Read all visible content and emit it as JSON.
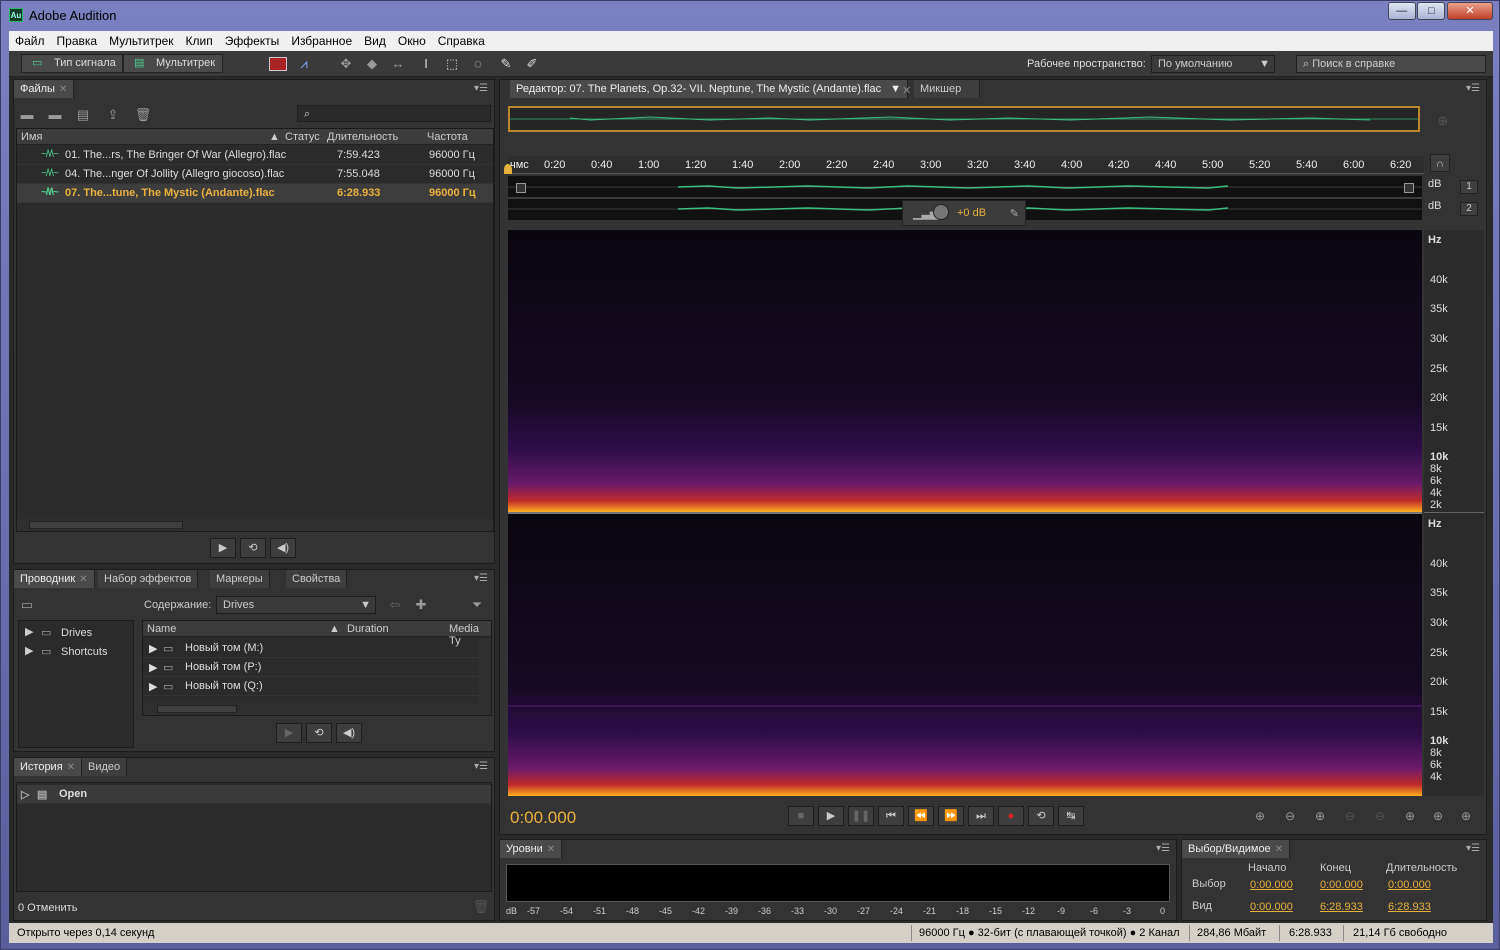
{
  "app": {
    "title": "Adobe Audition",
    "logo": "Au"
  },
  "window_controls": {
    "minimize": "—",
    "maximize": "□",
    "close": "✕"
  },
  "menu": [
    "Файл",
    "Правка",
    "Мультитрек",
    "Клип",
    "Эффекты",
    "Избранное",
    "Вид",
    "Окно",
    "Справка"
  ],
  "toolbar": {
    "waveform_btn": "Тип сигнала",
    "multitrack_btn": "Мультитрек",
    "workspace_label": "Рабочее пространство:",
    "workspace_value": "По умолчанию",
    "help_search": "Поиск в справке"
  },
  "files_panel": {
    "tab": "Файлы",
    "columns": [
      "Имя",
      "Статус",
      "Длительность",
      "Частота"
    ],
    "rows": [
      {
        "name": "01. The...rs, The Bringer Of War (Allegro).flac",
        "duration": "7:59.423",
        "rate": "96000 Гц"
      },
      {
        "name": "04. The...nger Of Jollity (Allegro giocoso).flac",
        "duration": "7:55.048",
        "rate": "96000 Гц"
      },
      {
        "name": "07. The...tune, The Mystic (Andante).flac",
        "duration": "6:28.933",
        "rate": "96000 Гц"
      }
    ],
    "selected": 2
  },
  "browser_panel": {
    "tabs": [
      "Проводник",
      "Набор эффектов",
      "Маркеры",
      "Свойства"
    ],
    "content_label": "Содержание:",
    "content_value": "Drives",
    "tree": [
      "Drives",
      "Shortcuts"
    ],
    "columns": [
      "Name",
      "Duration",
      "Media Ty"
    ],
    "items": [
      "Новый том (M:)",
      "Новый том (P:)",
      "Новый том (Q:)"
    ]
  },
  "history_panel": {
    "tabs": [
      "История",
      "Видео"
    ],
    "entries": [
      "Open"
    ],
    "undo_count": "0 Отменить"
  },
  "editor": {
    "tab": "Редактор: 07. The Planets, Op.32- VII. Neptune, The Mystic (Andante).flac",
    "mixer_tab": "Микшер",
    "ruler_unit": "чмс",
    "ruler": [
      "0:20",
      "0:40",
      "1:00",
      "1:20",
      "1:40",
      "2:00",
      "2:20",
      "2:40",
      "3:00",
      "3:20",
      "3:40",
      "4:00",
      "4:20",
      "4:40",
      "5:00",
      "5:20",
      "5:40",
      "6:00",
      "6:20"
    ],
    "db_label": "dB",
    "channel_1": "1",
    "channel_2": "2",
    "gain": "+0 dB",
    "hz_label": "Hz",
    "freq_ticks": [
      "40k",
      "35k",
      "30k",
      "25k",
      "20k",
      "15k",
      "10k",
      "8k",
      "6k",
      "4k",
      "2k"
    ],
    "timecode": "0:00.000"
  },
  "levels": {
    "tab": "Уровни",
    "ticks": [
      "dB",
      "-57",
      "-54",
      "-51",
      "-48",
      "-45",
      "-42",
      "-39",
      "-36",
      "-33",
      "-30",
      "-27",
      "-24",
      "-21",
      "-18",
      "-15",
      "-12",
      "-9",
      "-6",
      "-3",
      "0"
    ]
  },
  "selection": {
    "tab": "Выбор/Видимое",
    "headers": [
      "Начало",
      "Конец",
      "Длительность"
    ],
    "rows": [
      {
        "label": "Выбор",
        "start": "0:00.000",
        "end": "0:00.000",
        "duration": "0:00.000"
      },
      {
        "label": "Вид",
        "start": "0:00.000",
        "end": "6:28.933",
        "duration": "6:28.933"
      }
    ]
  },
  "statusbar": {
    "left": "Открыто через 0,14 секунд",
    "format": "96000 Гц ● 32-бит (с плавающей точкой) ● 2 Канал",
    "size": "284,86 Мбайт",
    "duration": "6:28.933",
    "free": "21,14 Гб свободно"
  }
}
